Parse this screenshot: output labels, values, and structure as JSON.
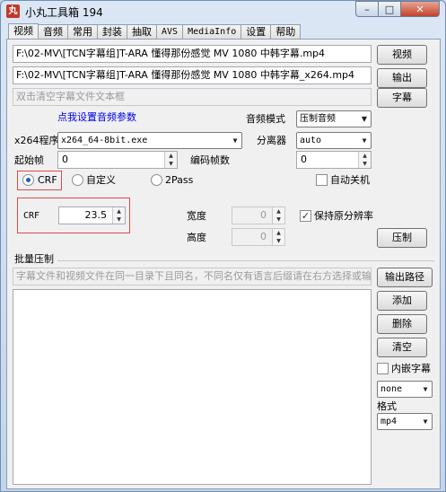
{
  "window": {
    "title": "小丸工具箱 194"
  },
  "tabs": [
    {
      "label": "视频",
      "active": true
    },
    {
      "label": "音频"
    },
    {
      "label": "常用"
    },
    {
      "label": "封装"
    },
    {
      "label": "抽取"
    },
    {
      "label": "AVS"
    },
    {
      "label": "MediaInfo"
    },
    {
      "label": "设置"
    },
    {
      "label": "帮助"
    }
  ],
  "files": {
    "input_video": "F:\\02-MV\\[TCN字幕组]T-ARA 懂得那份感觉 MV 1080 中韩字幕.mp4",
    "output_video": "F:\\02-MV\\[TCN字幕组]T-ARA 懂得那份感觉 MV 1080 中韩字幕_x264.mp4",
    "subtitle_placeholder": "双击清空字幕文件文本框"
  },
  "buttons": {
    "video": "视频",
    "output": "输出",
    "subtitle": "字幕",
    "compress": "压制",
    "output_path": "输出路径",
    "add": "添加",
    "delete": "删除",
    "clear": "清空"
  },
  "audio_settings": {
    "link": "点我设置音频参数",
    "mode_label": "音频模式",
    "mode_value": "压制音频",
    "splitter_label": "分离器",
    "splitter_value": "auto"
  },
  "encoder": {
    "x264_label": "x264程序",
    "x264_value": "x264_64-8bit.exe",
    "start_frame_label": "起始帧",
    "start_frame_value": "0",
    "encode_frames_label": "编码帧数",
    "encode_frames_value": "0"
  },
  "mode": {
    "crf": "CRF",
    "custom": "自定义",
    "twopass": "2Pass",
    "shutdown": "自动关机",
    "crf_label": "CRF",
    "crf_value": "23.5"
  },
  "resize": {
    "width_label": "宽度",
    "width_value": "0",
    "height_label": "高度",
    "height_value": "0",
    "keep_res": "保持原分辨率"
  },
  "batch": {
    "title": "批量压制",
    "hint": "字幕文件和视频文件在同一目录下且同名，不同名仅有语言后缀请在右方选择或输入",
    "embed_sub": "内嵌字幕",
    "lang_value": "none",
    "format_label": "格式",
    "format_value": "mp4"
  }
}
